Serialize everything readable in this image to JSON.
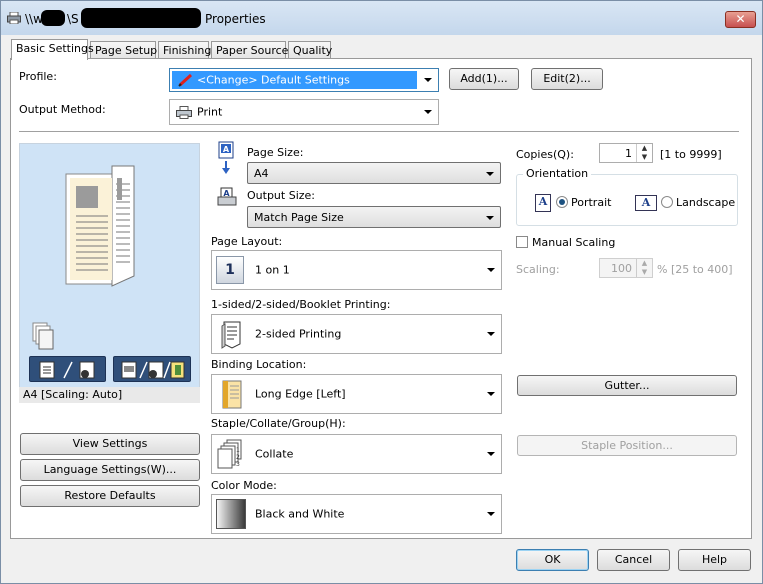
{
  "window": {
    "path_prefix": "\\\\w",
    "path_mid": "\\S",
    "title_suffix": "Properties",
    "close_label": "✕"
  },
  "tabs": [
    {
      "label": "Basic Settings",
      "active": true
    },
    {
      "label": "Page Setup"
    },
    {
      "label": "Finishing"
    },
    {
      "label": "Paper Source"
    },
    {
      "label": "Quality"
    }
  ],
  "profile": {
    "label": "Profile:",
    "value": "<Change> Default Settings",
    "add_label": "Add(1)...",
    "edit_label": "Edit(2)..."
  },
  "output_method": {
    "label": "Output Method:",
    "value": "Print"
  },
  "page_size": {
    "label": "Page Size:",
    "value": "A4"
  },
  "output_size": {
    "label": "Output Size:",
    "value": "Match Page Size"
  },
  "page_layout": {
    "label": "Page Layout:",
    "value": "1 on 1",
    "icon_text": "1"
  },
  "sided": {
    "label": "1-sided/2-sided/Booklet Printing:",
    "value": "2-sided Printing"
  },
  "binding": {
    "label": "Binding Location:",
    "value": "Long Edge [Left]"
  },
  "staple": {
    "label": "Staple/Collate/Group(H):",
    "value": "Collate"
  },
  "color_mode": {
    "label": "Color Mode:",
    "value": "Black and White"
  },
  "preview": {
    "caption": "A4 [Scaling: Auto]"
  },
  "left_buttons": {
    "view": "View Settings",
    "language": "Language Settings(W)...",
    "restore": "Restore Defaults"
  },
  "copies": {
    "label": "Copies(Q):",
    "value": "1",
    "range": "[1 to 9999]"
  },
  "orientation": {
    "legend": "Orientation",
    "portrait": "Portrait",
    "landscape": "Landscape",
    "icon_letter": "A",
    "selected": "portrait"
  },
  "manual_scaling": {
    "label": "Manual Scaling",
    "checked": false
  },
  "scaling": {
    "label": "Scaling:",
    "value": "100",
    "range": "% [25 to 400]"
  },
  "gutter_label": "Gutter...",
  "staple_position_label": "Staple Position...",
  "footer": {
    "ok": "OK",
    "cancel": "Cancel",
    "help": "Help"
  },
  "colors": {
    "preview_bg": "#cfe3f6",
    "accent": "#3c7fb1",
    "close": "#c75050"
  }
}
